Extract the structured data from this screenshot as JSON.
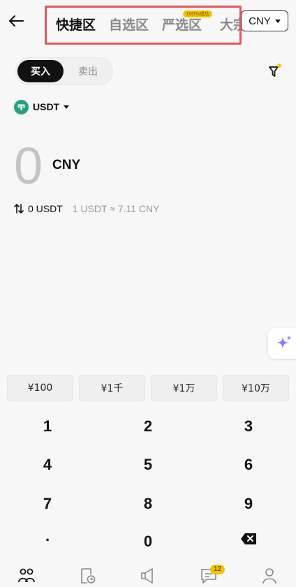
{
  "header": {
    "tabs": [
      {
        "label": "快捷区"
      },
      {
        "label": "自选区"
      },
      {
        "label": "严选区"
      },
      {
        "label": "大宗"
      }
    ],
    "tab_badge": "100%成功",
    "currency": "CNY"
  },
  "trade_toggle": {
    "buy": "买入",
    "sell": "卖出"
  },
  "coin": {
    "label": "USDT",
    "icon": "tether-icon"
  },
  "amount": {
    "value": "0",
    "unit": "CNY"
  },
  "conversion": {
    "receive": "0 USDT",
    "rate": "1 USDT ≈ 7.11 CNY"
  },
  "quick_amounts": [
    "¥100",
    "¥1千",
    "¥1万",
    "¥10万"
  ],
  "keypad": [
    "1",
    "2",
    "3",
    "4",
    "5",
    "6",
    "7",
    "8",
    "9",
    ".",
    "0"
  ],
  "bottom_nav": {
    "items": [
      "p2p-icon",
      "orders-icon",
      "ads-icon",
      "chat-icon",
      "profile-icon"
    ],
    "chat_badge": "12"
  },
  "colors": {
    "highlight_border": "#e5555f",
    "coin_green": "#26a17b",
    "badge_yellow": "#f5c400"
  }
}
